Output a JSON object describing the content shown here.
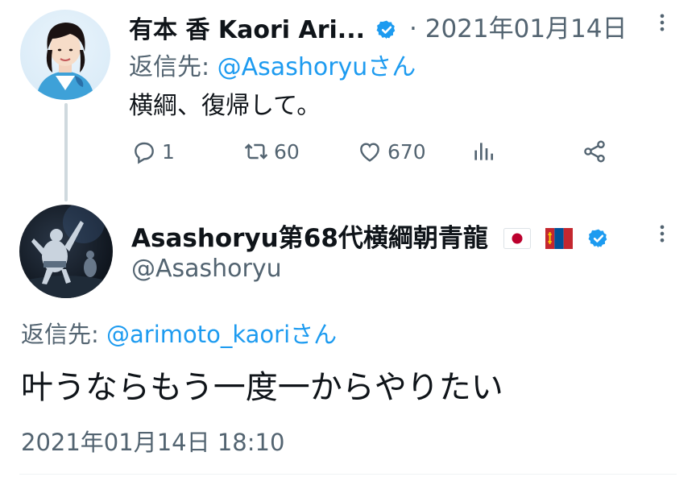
{
  "tweet1": {
    "author_name": "有本 香 Kaori Ari...",
    "separator": "·",
    "date": "2021年01月14日",
    "reply_prefix": "返信先: ",
    "reply_mention": "@Asashoryu",
    "reply_suffix": "さん",
    "text": "横綱、復帰して。",
    "actions": {
      "reply_count": "1",
      "retweet_count": "60",
      "like_count": "670"
    }
  },
  "tweet2": {
    "author_name": "Asashoryu第68代横綱朝青龍",
    "handle": "@Asashoryu",
    "reply_prefix": "返信先: ",
    "reply_mention": "@arimoto_kaori",
    "reply_suffix": "さん",
    "text": "叶うならもう一度一からやりたい",
    "timestamp": "2021年01月14日 18:10"
  },
  "colors": {
    "accent": "#1d9bf0",
    "secondary_text": "#536471",
    "primary_text": "#0f1419",
    "verified": "#1d9bf0",
    "thread_line": "#cfd9de"
  },
  "icons": [
    "verified-badge-icon",
    "more-icon",
    "reply-icon",
    "retweet-icon",
    "like-icon",
    "analytics-icon",
    "share-icon",
    "japan-flag-icon",
    "mongolia-flag-icon"
  ]
}
